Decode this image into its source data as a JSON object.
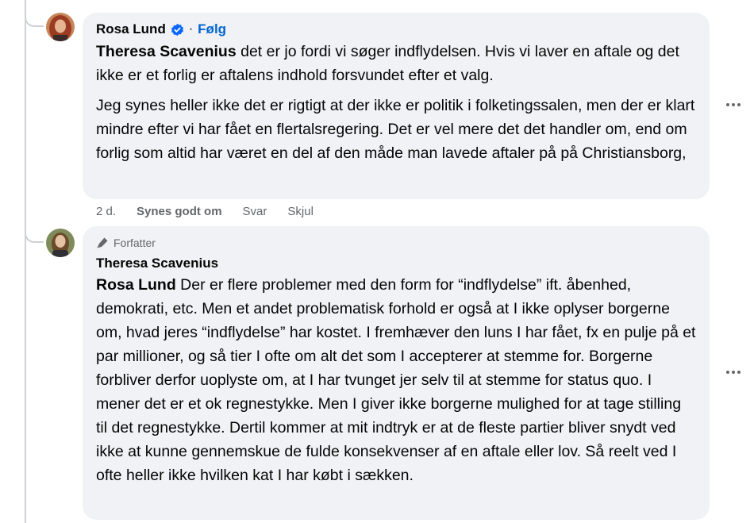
{
  "comment1": {
    "author": "Rosa Lund",
    "separator": "·",
    "follow_label": "Følg",
    "mention": "Theresa Scavenius",
    "para1_rest": " det er jo fordi vi søger indflydelsen. Hvis vi laver en aftale og det ikke er et forlig er aftalens indhold forsvundet efter et valg.",
    "para2": "Jeg synes heller ikke det er rigtigt at der ikke er politik i folketingssalen, men der er klart mindre efter vi har fået en flertalsregering. Det er vel mere det det handler om, end om forlig som altid har været en del af den måde man lavede aftaler på på Christiansborg,",
    "time": "2 d.",
    "like_label": "Synes godt om",
    "reply_label": "Svar",
    "hide_label": "Skjul",
    "verified_icon": "verified-badge-icon",
    "avatar_colors": {
      "hair": "#9b3b22",
      "skin": "#e5b592",
      "bg": "#c7865a"
    }
  },
  "comment2": {
    "badge_label": "Forfatter",
    "badge_icon": "pen-icon",
    "author": "Theresa Scavenius",
    "mention": "Rosa Lund",
    "body_rest": " Der er flere problemer med den form for “indflydelse” ift. åbenhed, demokrati, etc. Men et andet problematisk forhold er også at I ikke oplyser borgerne om, hvad jeres “indflydelse” har kostet. I fremhæver den luns I har fået, fx en pulje på et par millioner, og så tier I ofte om alt det som I accepterer at stemme for. Borgerne forbliver derfor uoplyste om, at I har tvunget jer selv til at stemme for status quo. I mener det er et ok regnestykke. Men I giver ikke borgerne mulighed for at tage stilling til det regnestykke. Dertil kommer at mit indtryk er at de fleste partier bliver snydt ved ikke at kunne gennemskue de fulde konsekvenser af en aftale eller lov. Så reelt ved I ofte heller ikke hvilken kat I har købt i sækken.",
    "avatar_colors": {
      "hair": "#6b4a2a",
      "skin": "#e3c3a4",
      "bg": "#7f8a5a"
    }
  },
  "colors": {
    "bubble": "#f0f2f5",
    "link": "#0064d1",
    "meta": "#65676b",
    "verified": "#0866ff",
    "thread_line": "#ced0d4"
  }
}
